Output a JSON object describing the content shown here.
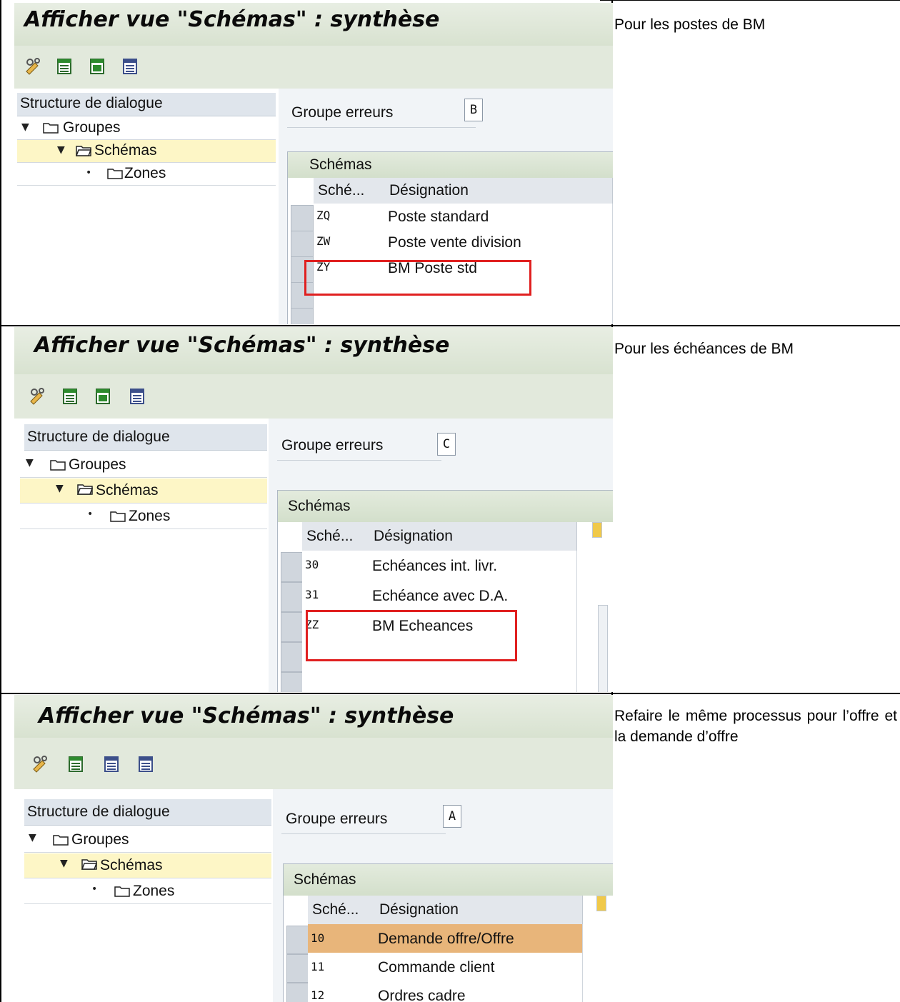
{
  "panels": [
    {
      "note": "Pour les postes de BM",
      "window_title": "Afficher vue \"Schémas\" : synthèse",
      "tree_header": "Structure de dialogue",
      "tree": [
        "Groupes",
        "Schémas",
        "Zones"
      ],
      "group_label": "Groupe erreurs",
      "group_value": "B",
      "table_title": "Schémas",
      "col_code": "Sché...",
      "col_desc": "Désignation",
      "rows": [
        {
          "code": "ZQ",
          "desc": "Poste standard"
        },
        {
          "code": "ZW",
          "desc": "Poste vente division"
        },
        {
          "code": "ZY",
          "desc": "BM Poste std"
        }
      ]
    },
    {
      "note": "Pour les échéances de BM",
      "window_title": "Afficher vue \"Schémas\" : synthèse",
      "tree_header": "Structure de dialogue",
      "tree": [
        "Groupes",
        "Schémas",
        "Zones"
      ],
      "group_label": "Groupe erreurs",
      "group_value": "C",
      "table_title": "Schémas",
      "col_code": "Sché...",
      "col_desc": "Désignation",
      "rows": [
        {
          "code": "30",
          "desc": "Echéances int. livr."
        },
        {
          "code": "31",
          "desc": "Echéance avec D.A."
        },
        {
          "code": "ZZ",
          "desc": "BM Echeances"
        }
      ]
    },
    {
      "note": "Refaire le même processus pour l’offre et la demande d’offre",
      "window_title": "Afficher vue \"Schémas\" : synthèse",
      "tree_header": "Structure de dialogue",
      "tree": [
        "Groupes",
        "Schémas",
        "Zones"
      ],
      "group_label": "Groupe erreurs",
      "group_value": "A",
      "table_title": "Schémas",
      "col_code": "Sché...",
      "col_desc": "Désignation",
      "rows": [
        {
          "code": "10",
          "desc": "Demande offre/Offre"
        },
        {
          "code": "11",
          "desc": "Commande client"
        },
        {
          "code": "12",
          "desc": "Ordres cadre"
        }
      ]
    }
  ],
  "colors": {
    "highlight_box": "#e02020",
    "selected_row": "#e8b57a",
    "selected_tree_node": "#fdf6c6"
  }
}
